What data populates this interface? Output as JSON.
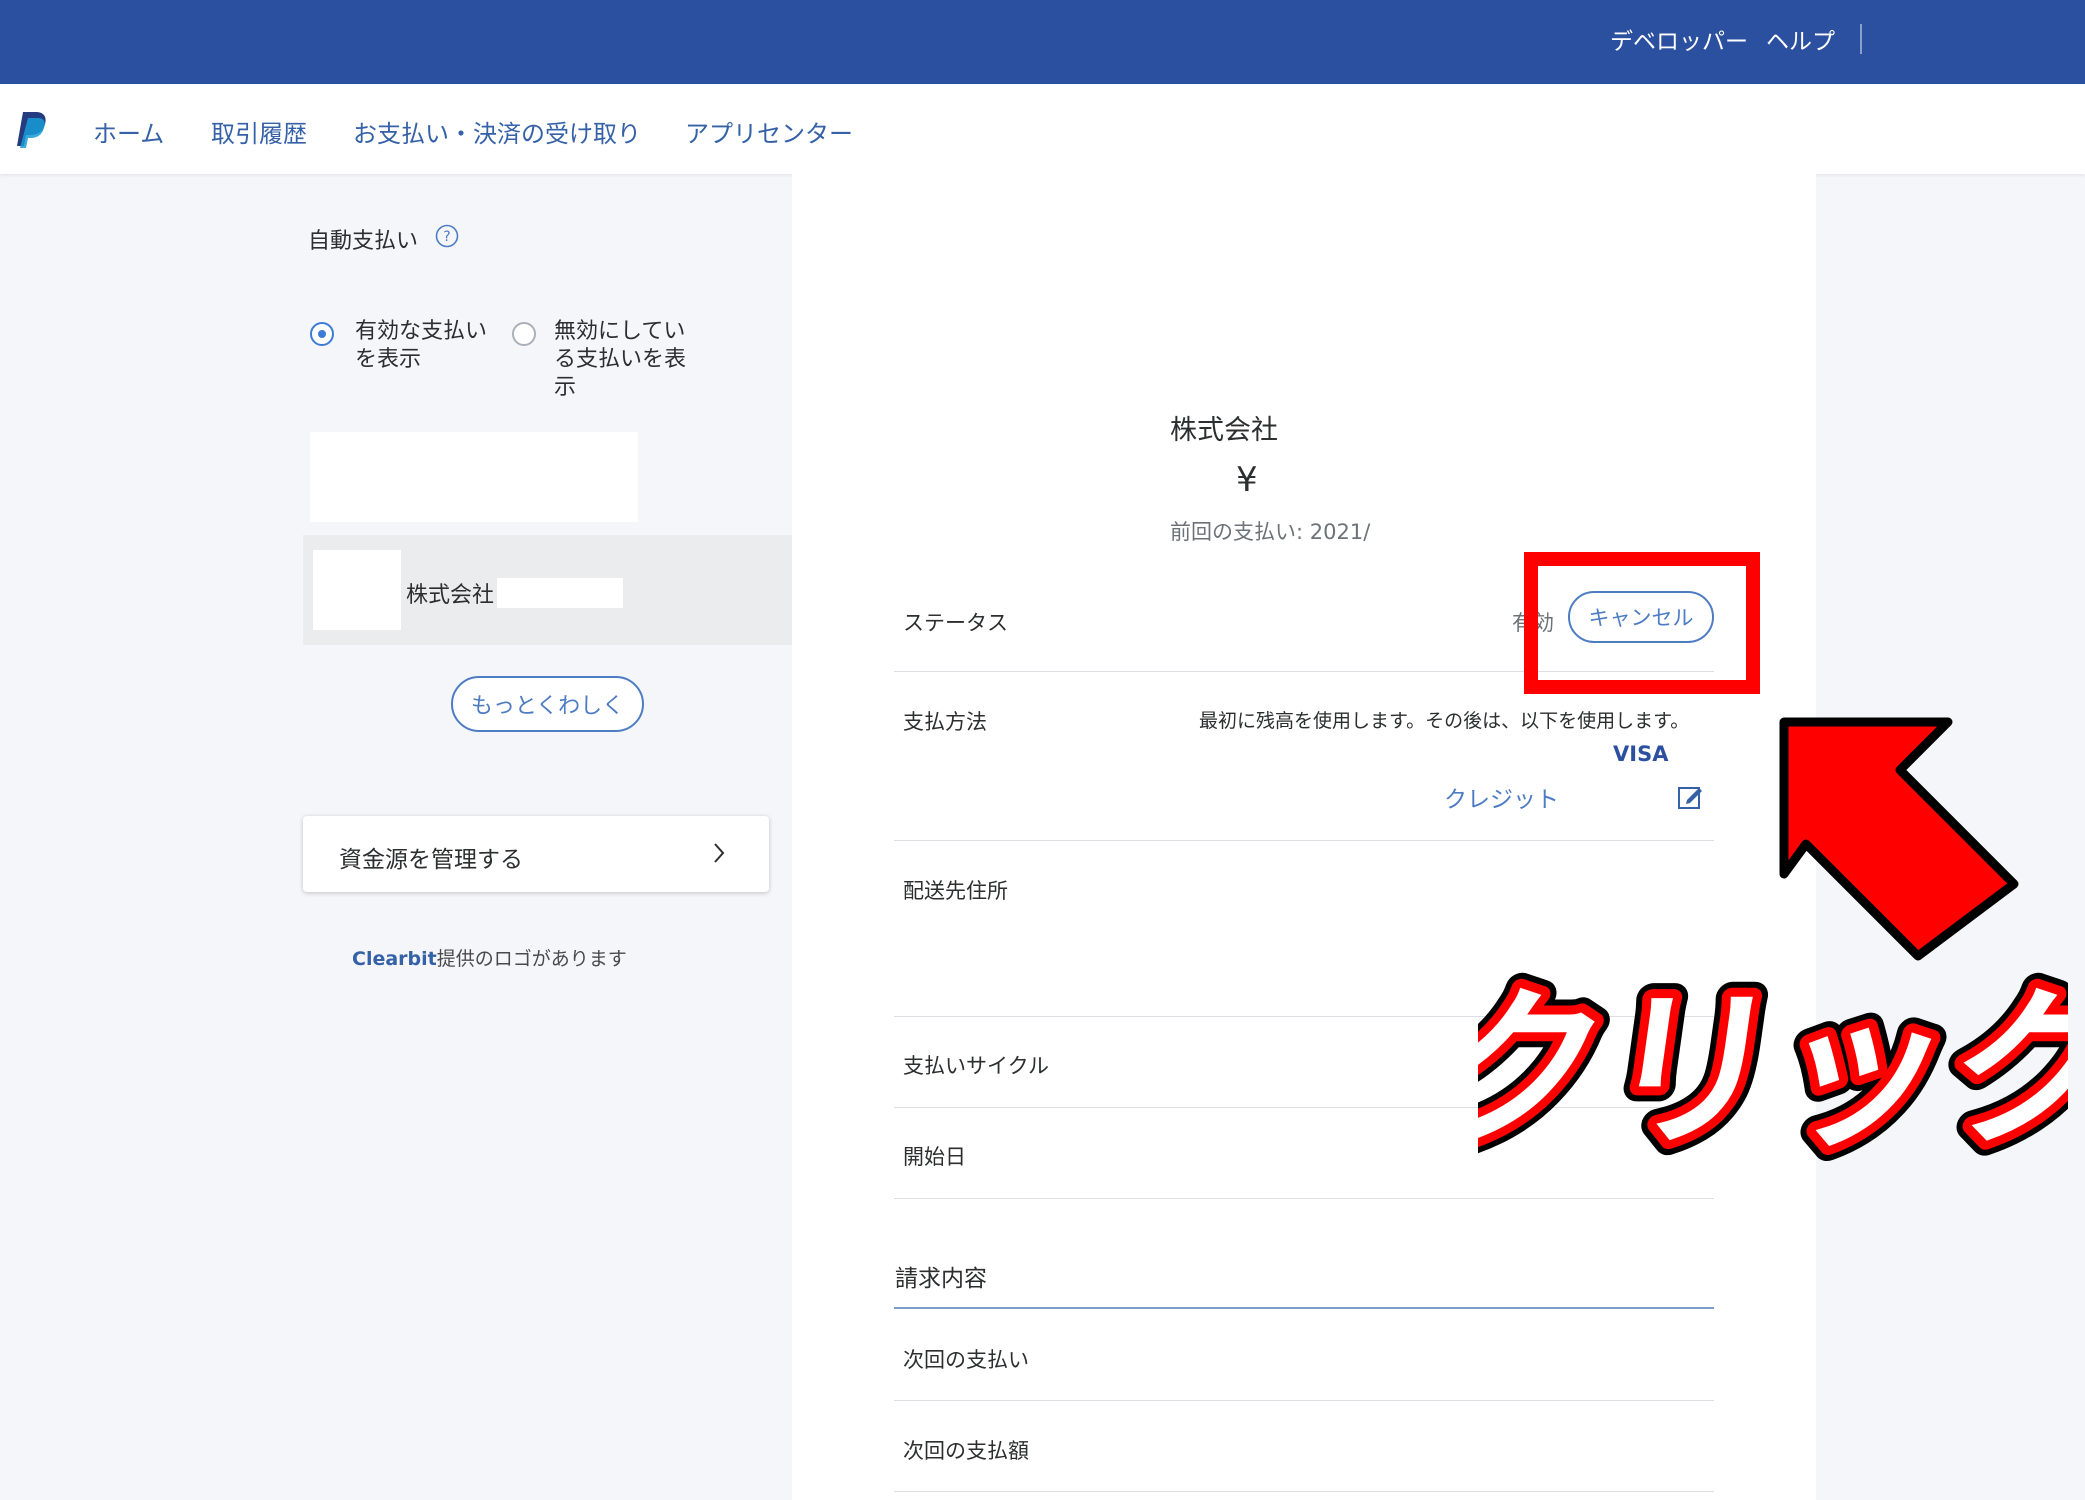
{
  "header": {
    "links": [
      "デベロッパー",
      "ヘルプ"
    ]
  },
  "nav": {
    "logo_icon": "paypal-logo-icon",
    "items": [
      "ホーム",
      "取引履歴",
      "お支払い・決済の受け取り",
      "アプリセンター"
    ]
  },
  "sidebar": {
    "title": "自動支払い",
    "help_icon": "question-icon",
    "filters": [
      {
        "label": "有効な支払いを表示",
        "lines": [
          "有効な支払い",
          "を表示"
        ],
        "selected": true
      },
      {
        "label": "無効にしている支払いを表示",
        "lines": [
          "無効にしてい",
          "る支払いを表",
          "示"
        ],
        "selected": false
      }
    ],
    "merchant_name": "株式会社",
    "more_button": "もっとくわしく",
    "manage_funds": "資金源を管理する",
    "credit_link": "Clearbit",
    "credit_text": "提供のロゴがあります"
  },
  "detail": {
    "merchant_name": "株式会社",
    "amount": "¥",
    "last_payment": "前回の支払い: 2021/",
    "status_label": "ステータス",
    "status_value": "有効",
    "cancel_button": "キャンセル",
    "payment_method_label": "支払方法",
    "payment_method_note": "最初に残高を使用します。その後は、以下を使用します。",
    "card_brand": "VISA",
    "card_type": "クレジット",
    "edit_icon": "edit-icon",
    "shipping_label": "配送先住所",
    "cycle_label": "支払いサイクル",
    "start_label": "開始日",
    "billing_section": "請求内容",
    "next_payment_label": "次回の支払い",
    "next_amount_label": "次回の支払額"
  },
  "annotation": {
    "text": "クリック",
    "arrow": "arrow-icon",
    "accent": "#ff0000"
  }
}
